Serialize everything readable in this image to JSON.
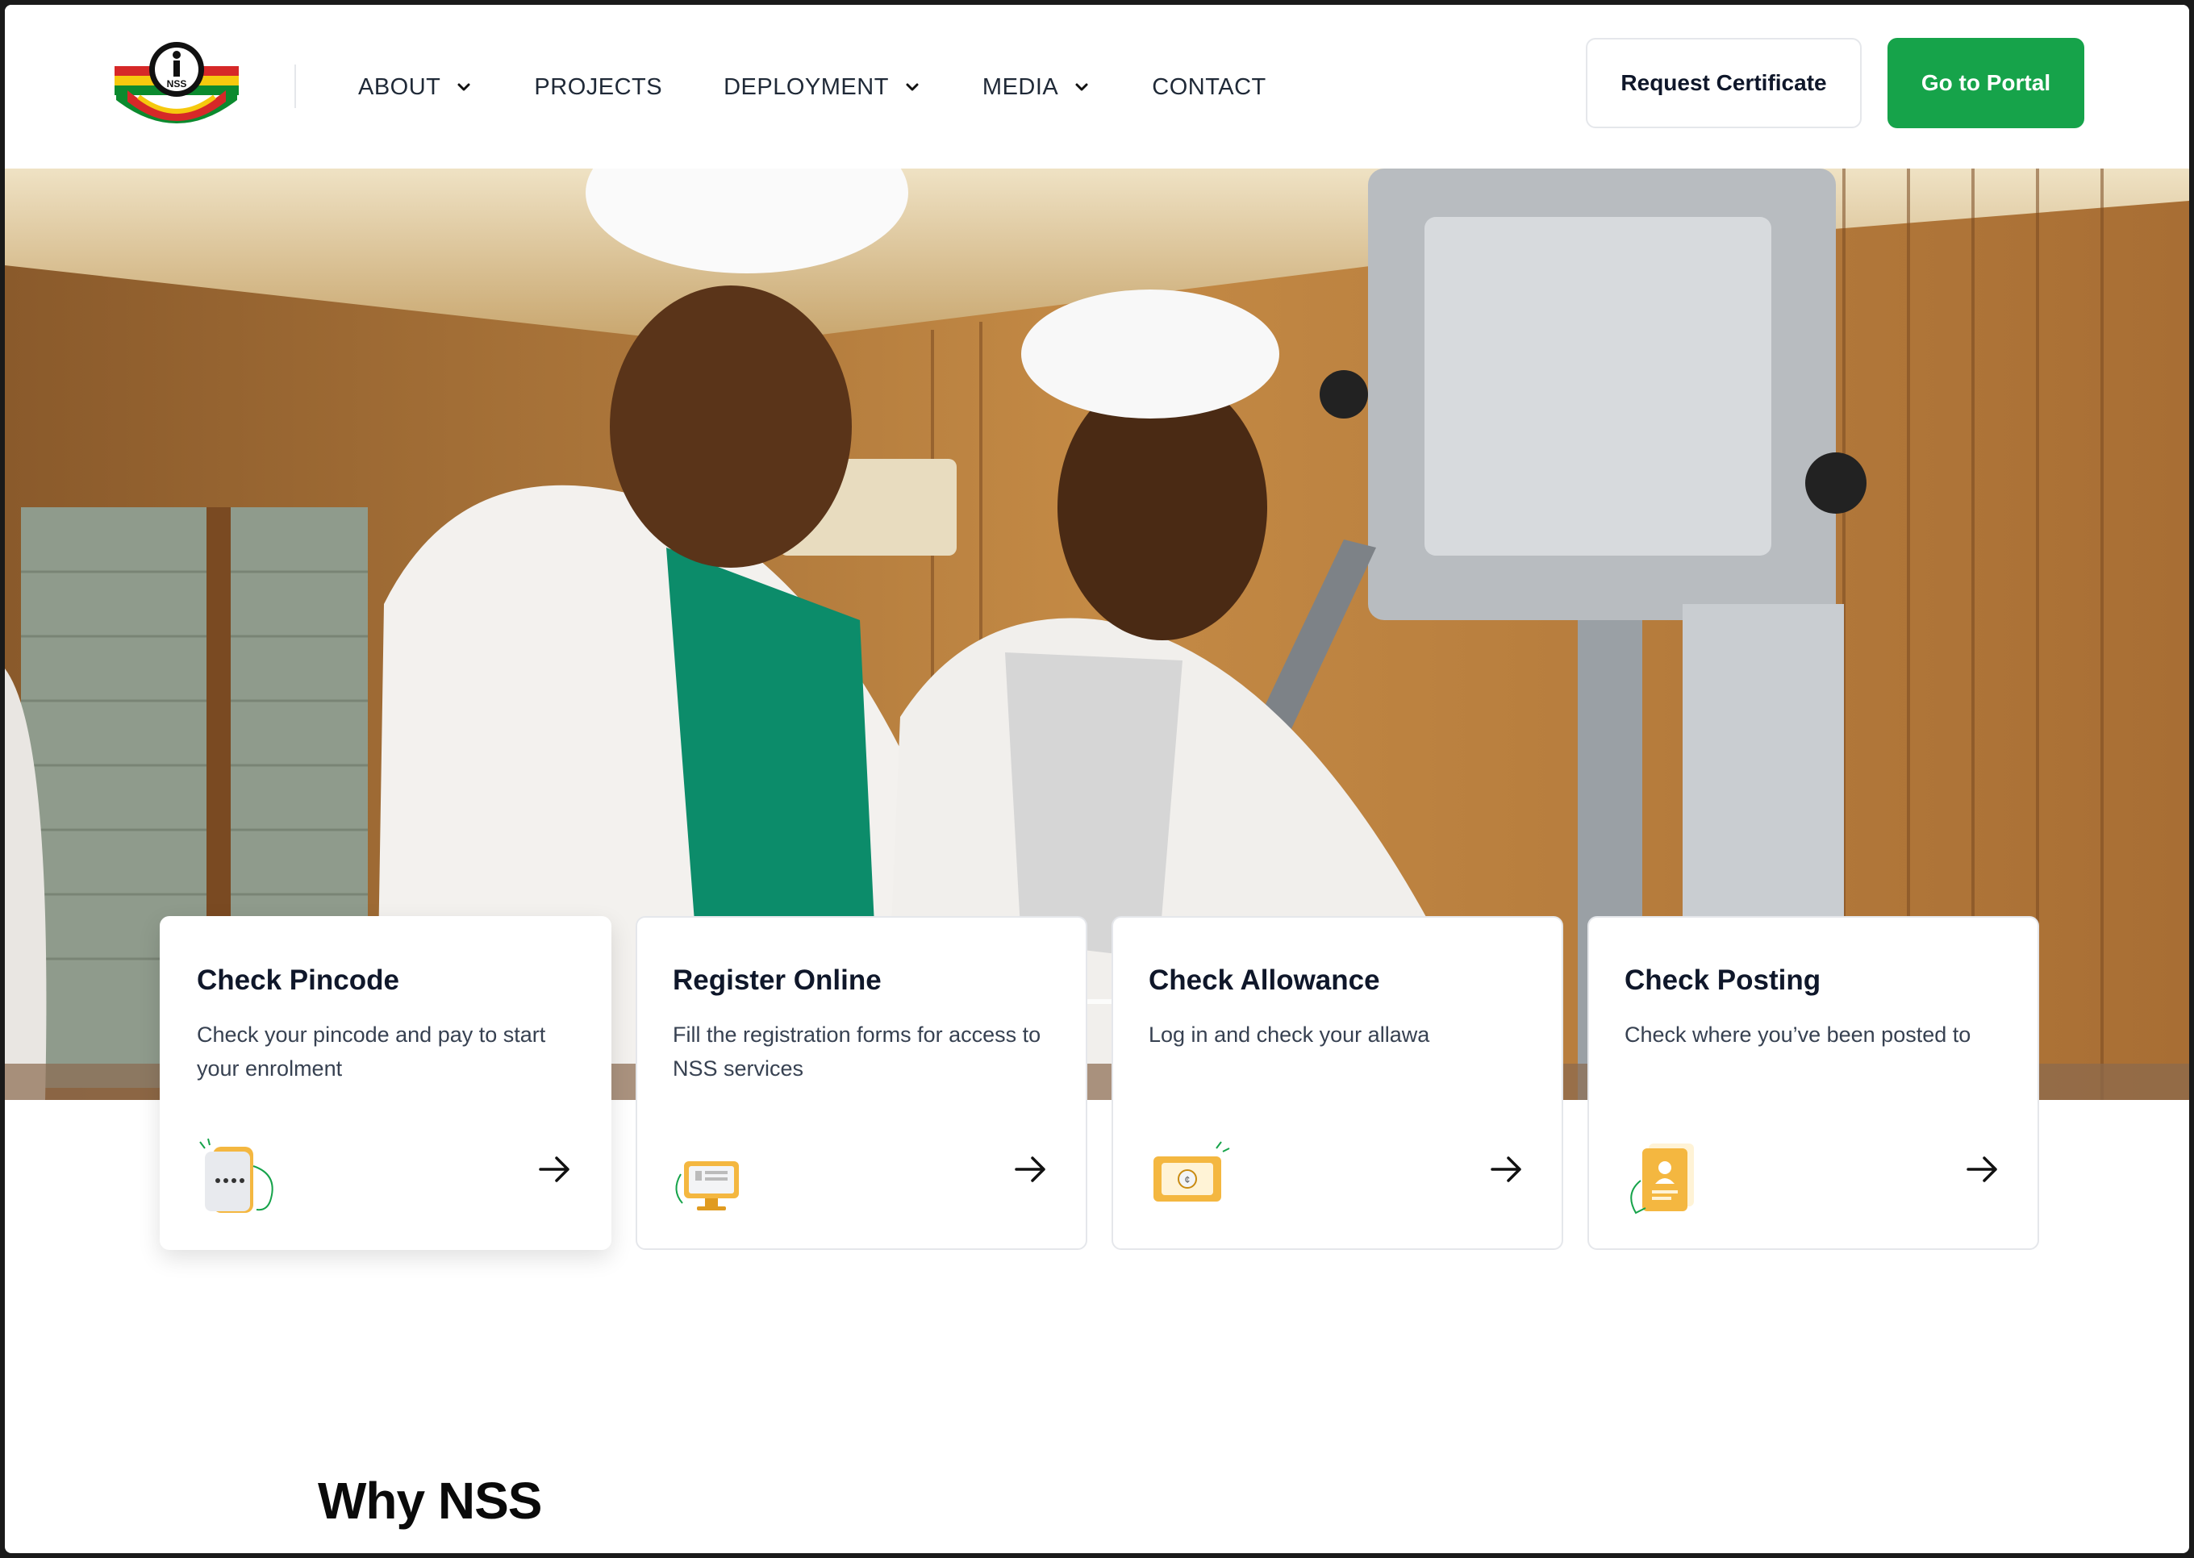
{
  "header": {
    "logo_alt": "NSS",
    "nav": [
      {
        "label": "ABOUT",
        "dropdown": true
      },
      {
        "label": "PROJECTS",
        "dropdown": false
      },
      {
        "label": "DEPLOYMENT",
        "dropdown": true
      },
      {
        "label": "MEDIA",
        "dropdown": true
      },
      {
        "label": "CONTACT",
        "dropdown": false
      }
    ],
    "request_certificate": "Request Certificate",
    "go_to_portal": "Go to Portal"
  },
  "hero": {
    "slides_total": 2,
    "active_slide": 2,
    "image": "two women in white coats and hairnets operating a machine"
  },
  "cards": [
    {
      "title": "Check Pincode",
      "desc": "Check your pincode and pay to start your enrolment",
      "icon": "phone-icon"
    },
    {
      "title": "Register Online",
      "desc": "Fill the registration forms for access to NSS services",
      "icon": "computer-icon"
    },
    {
      "title": "Check Allowance",
      "desc": "Log in and check your allawa",
      "icon": "money-icon"
    },
    {
      "title": "Check Posting",
      "desc": "Check where you’ve been posted to",
      "icon": "document-icon"
    }
  ],
  "section": {
    "why_title": "Why NSS"
  },
  "colors": {
    "brand_green": "#16a34a",
    "text_dark": "#0f172a",
    "icon_orange": "#f4b740"
  }
}
